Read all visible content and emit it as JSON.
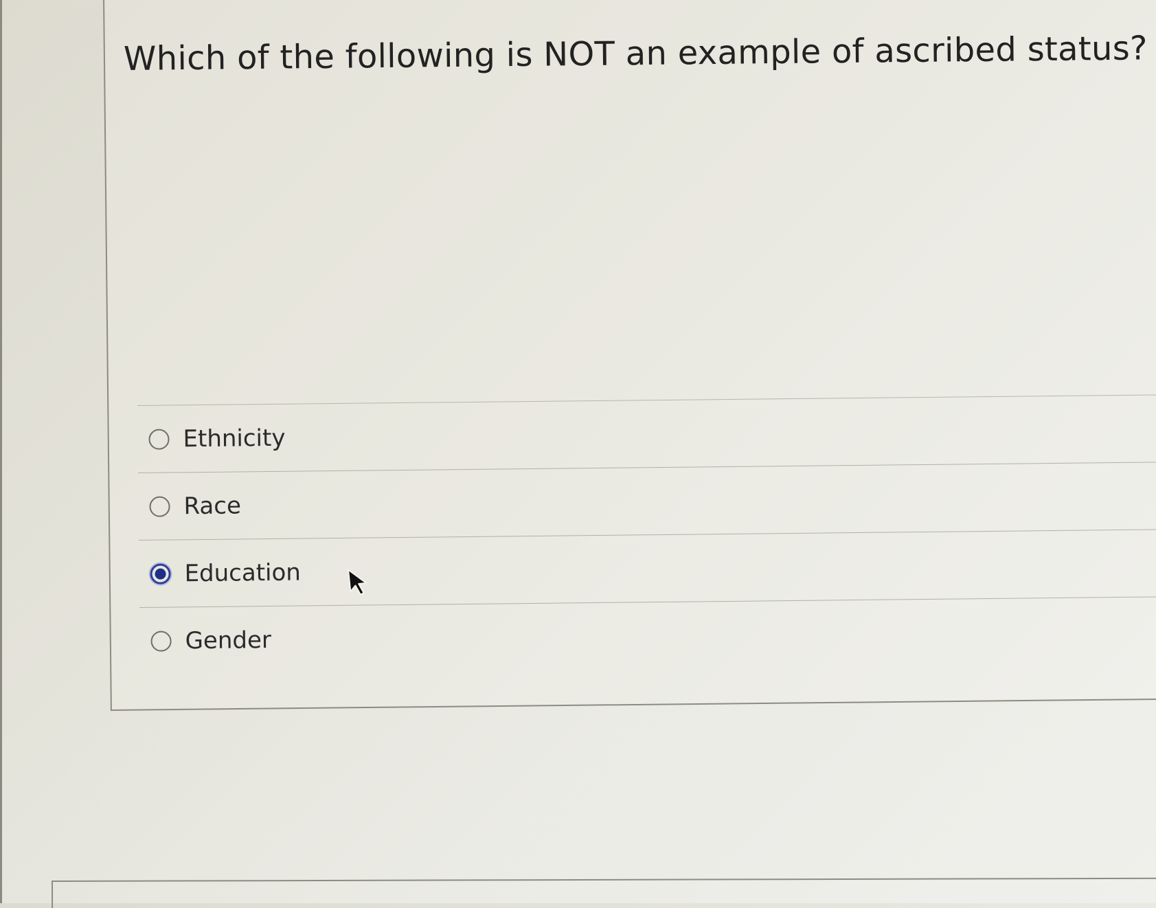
{
  "question": {
    "text": "Which of the following is NOT an example of ascribed status?"
  },
  "answers": [
    {
      "label": "Ethnicity",
      "selected": false
    },
    {
      "label": "Race",
      "selected": false
    },
    {
      "label": "Education",
      "selected": true
    },
    {
      "label": "Gender",
      "selected": false
    }
  ],
  "colors": {
    "selected_radio": "#1f2f86",
    "text": "#222222"
  },
  "icons": {
    "cursor": "mouse-pointer-icon",
    "radio": "radio-button-icon"
  }
}
